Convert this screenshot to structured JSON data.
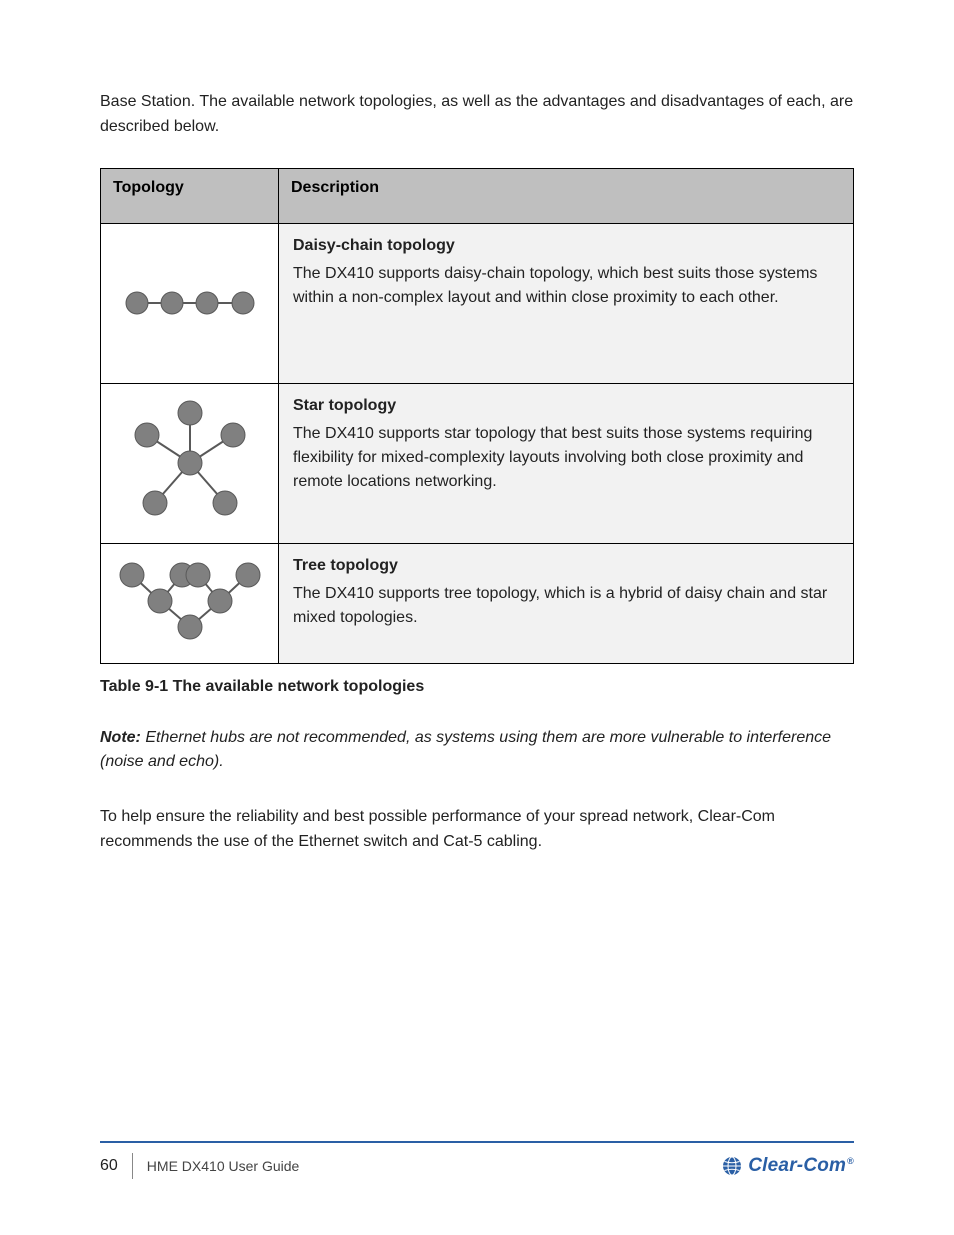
{
  "intro": "Base Station. The available network topologies, as well as the advantages and disadvantages of each, are described below.",
  "table": {
    "headers": {
      "col0": "Topology",
      "col1": "Description"
    },
    "rows": [
      {
        "name_key": "daisy-chain-diagram",
        "title": "Daisy-chain topology",
        "body": "The DX410 supports daisy-chain topology, which best suits those systems within a non-complex layout and within close proximity to each other."
      },
      {
        "name_key": "star-diagram",
        "title": "Star topology",
        "body": "The DX410 supports star topology that best suits those systems requiring flexibility for mixed-complexity layouts involving both close proximity and remote locations networking."
      },
      {
        "name_key": "tree-diagram",
        "title": "Tree topology",
        "body": "The DX410 supports tree topology, which is a hybrid of daisy chain and star mixed topologies."
      }
    ]
  },
  "caption": "Table 9-1 The available network topologies",
  "note": {
    "label": "Note:",
    "text": " Ethernet hubs are not recommended, as systems using them are more vulnerable to interference (noise and echo)."
  },
  "para2": "To help ensure the reliability and best possible performance of your spread network, Clear-Com recommends the use of the Ethernet switch and Cat-5 cabling.",
  "footer": {
    "page": "60",
    "doc": "HME DX410 User Guide"
  },
  "logo_text": "Clear-Com"
}
